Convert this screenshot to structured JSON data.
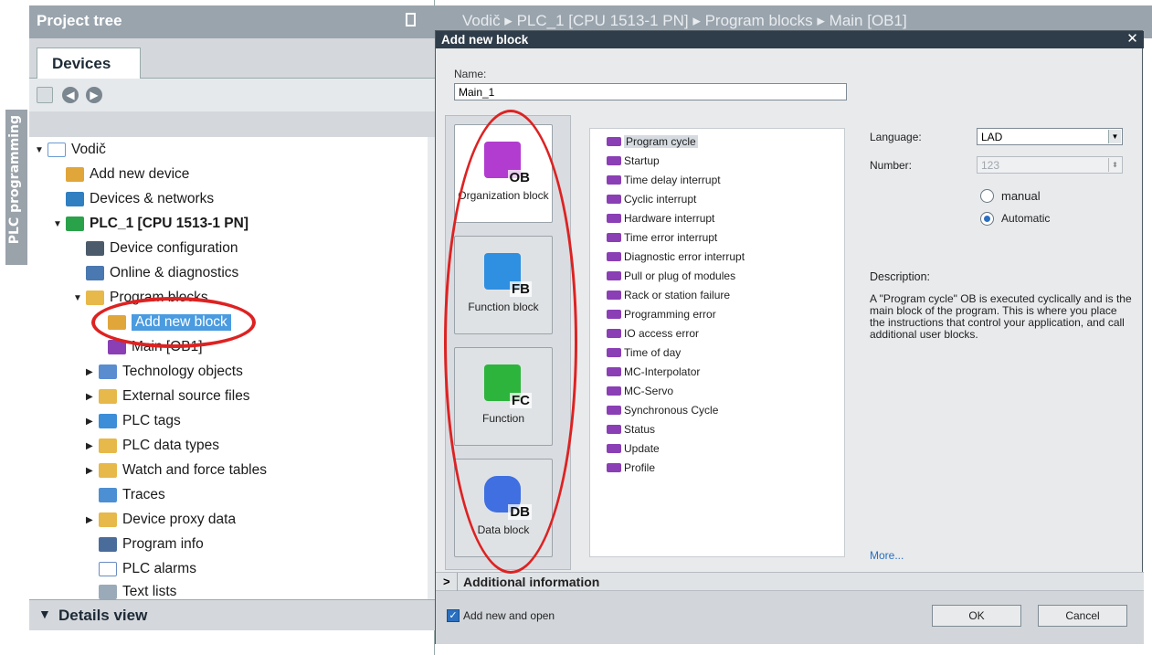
{
  "side_tab": {
    "label": "PLC programming"
  },
  "project_tree": {
    "title": "Project tree",
    "tab": "Devices",
    "items": [
      {
        "label": "Vodič"
      },
      {
        "label": "Add new device"
      },
      {
        "label": "Devices & networks"
      },
      {
        "label": "PLC_1 [CPU 1513-1 PN]"
      },
      {
        "label": "Device configuration"
      },
      {
        "label": "Online & diagnostics"
      },
      {
        "label": "Program blocks"
      },
      {
        "label": "Add new block"
      },
      {
        "label": "Main [OB1]"
      },
      {
        "label": "Technology objects"
      },
      {
        "label": "External source files"
      },
      {
        "label": "PLC tags"
      },
      {
        "label": "PLC data types"
      },
      {
        "label": "Watch and force tables"
      },
      {
        "label": "Traces"
      },
      {
        "label": "Device proxy data"
      },
      {
        "label": "Program info"
      },
      {
        "label": "PLC alarms"
      },
      {
        "label": "Text lists"
      }
    ],
    "details_view": "Details view"
  },
  "editor": {
    "path": "Vodič ▸ PLC_1 [CPU 1513-1 PN] ▸ Program blocks ▸ Main [OB1]"
  },
  "dialog": {
    "title": "Add new block",
    "close": "✕",
    "name_label": "Name:",
    "name_value": "Main_1",
    "block_types": [
      {
        "caption": "OB",
        "label": "Organization block",
        "color": "#b23cd0"
      },
      {
        "caption": "FB",
        "label": "Function block",
        "color": "#2f8fe0"
      },
      {
        "caption": "FC",
        "label": "Function",
        "color": "#2db43c"
      },
      {
        "caption": "DB",
        "label": "Data block",
        "color": "#3f6fe0"
      }
    ],
    "ob_types": [
      "Program cycle",
      "Startup",
      "Time delay interrupt",
      "Cyclic interrupt",
      "Hardware interrupt",
      "Time error interrupt",
      "Diagnostic error interrupt",
      "Pull or plug of modules",
      "Rack or station failure",
      "Programming error",
      "IO access error",
      "Time of day",
      "MC-Interpolator",
      "MC-Servo",
      "Synchronous Cycle",
      "Status",
      "Update",
      "Profile"
    ],
    "language_label": "Language:",
    "language_value": "LAD",
    "number_label": "Number:",
    "number_value": "123",
    "manual_label": "manual",
    "automatic_label": "Automatic",
    "description_label": "Description:",
    "description_text": "A \"Program cycle\" OB is executed cyclically and is the main block of the program. This is where you place the instructions that control your application, and call additional user blocks.",
    "more_link": "More...",
    "additional_info": "Additional  information",
    "add_new_and_open": "Add new and open",
    "ok": "OK",
    "cancel": "Cancel"
  }
}
